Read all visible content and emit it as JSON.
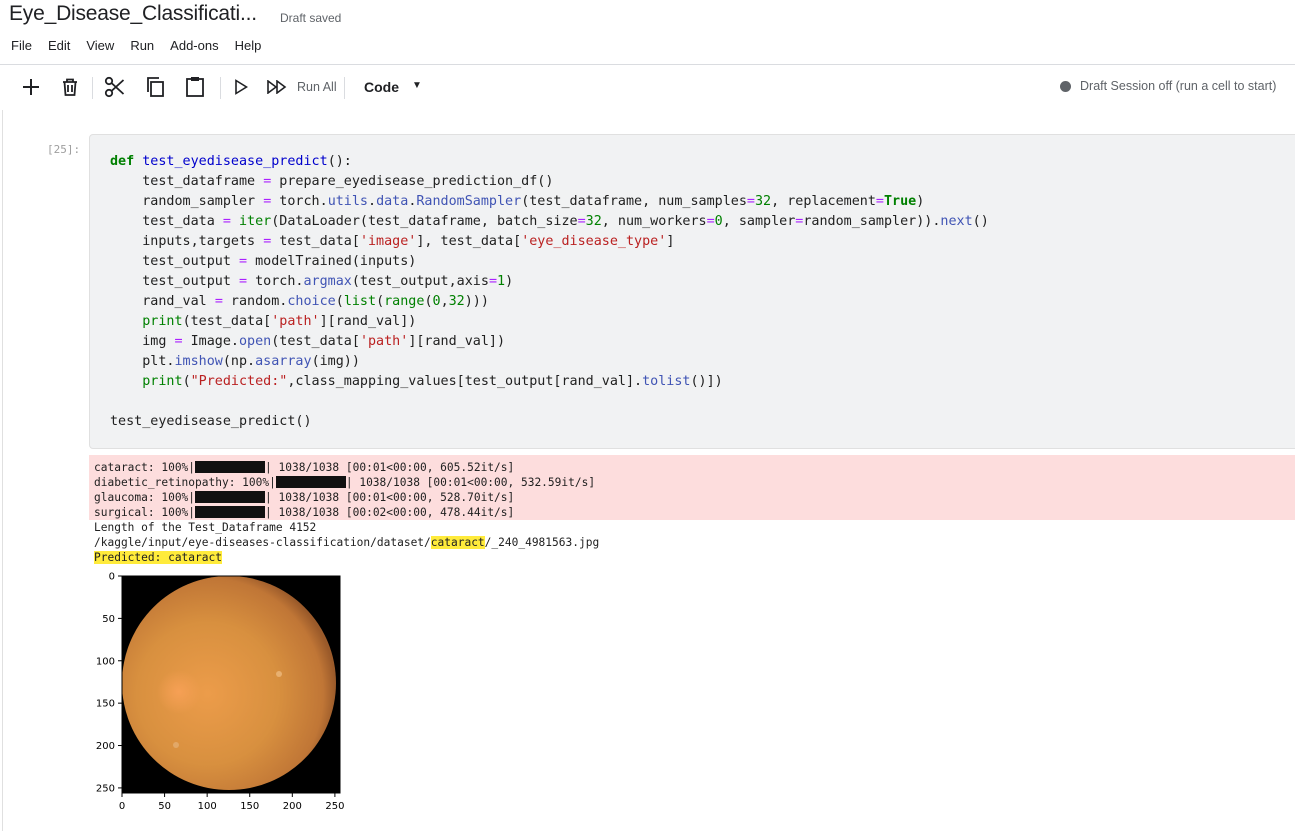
{
  "header": {
    "title": "Eye_Disease_Classificati...",
    "status": "Draft saved"
  },
  "menu": [
    "File",
    "Edit",
    "View",
    "Run",
    "Add-ons",
    "Help"
  ],
  "toolbar": {
    "run_all_label": "Run All",
    "cell_type": "Code",
    "session_status": "Draft Session off (run a cell to start)",
    "icons": [
      "plus-icon",
      "trash-icon",
      "scissors-icon",
      "copy-icon",
      "paste-icon",
      "play-icon",
      "fast-forward-icon",
      "caret-down-icon"
    ]
  },
  "cell": {
    "prompt": "[25]:",
    "code_lines": [
      "def test_eyedisease_predict():",
      "    test_dataframe = prepare_eyedisease_prediction_df()",
      "    random_sampler = torch.utils.data.RandomSampler(test_dataframe, num_samples=32, replacement=True)",
      "    test_data = iter(DataLoader(test_dataframe, batch_size=32, num_workers=0, sampler=random_sampler)).next()",
      "    inputs,targets = test_data['image'], test_data['eye_disease_type']",
      "    test_output = modelTrained(inputs)",
      "    test_output = torch.argmax(test_output,axis=1)",
      "    rand_val = random.choice(list(range(0,32)))",
      "    print(test_data['path'][rand_val])",
      "    img = Image.open(test_data['path'][rand_val])",
      "    plt.imshow(np.asarray(img))",
      "    print(\"Predicted:\",class_mapping_values[test_output[rand_val].tolist()])",
      "",
      "test_eyedisease_predict()"
    ]
  },
  "output": {
    "progress": [
      {
        "label": "cataract: 100%|",
        "stats": "| 1038/1038 [00:01<00:00, 605.52it/s]"
      },
      {
        "label": "diabetic_retinopathy: 100%|",
        "stats": "| 1038/1038 [00:01<00:00, 532.59it/s]"
      },
      {
        "label": "glaucoma: 100%|",
        "stats": "| 1038/1038 [00:01<00:00, 528.70it/s]"
      },
      {
        "label": "surgical: 100%|",
        "stats": "| 1038/1038 [00:02<00:00, 478.44it/s]"
      }
    ],
    "length_line": "Length of the Test_Dataframe 4152",
    "path_prefix": "/kaggle/input/eye-diseases-classification/dataset/",
    "path_highlight": "cataract",
    "path_suffix": "/_240_4981563.jpg",
    "predicted": "Predicted: cataract"
  },
  "plot": {
    "yticks": [
      "0",
      "50",
      "100",
      "150",
      "200",
      "250"
    ],
    "xticks": [
      "0",
      "50",
      "100",
      "150",
      "200",
      "250"
    ],
    "image_colors": {
      "background": "#000000",
      "fundus_center": "#e69a45",
      "fundus_edge": "#b8733a"
    }
  }
}
